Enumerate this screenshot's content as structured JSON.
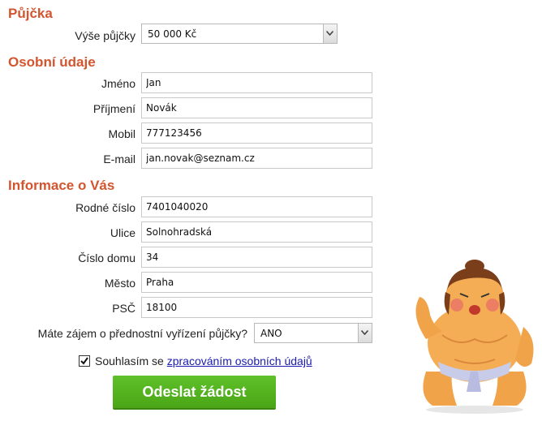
{
  "loan": {
    "title": "Půjčka",
    "amount_label": "Výše půjčky",
    "amount_value": "50 000 Kč"
  },
  "personal": {
    "title": "Osobní údaje",
    "first_name_label": "Jméno",
    "first_name_value": "Jan",
    "last_name_label": "Příjmení",
    "last_name_value": "Novák",
    "mobile_label": "Mobil",
    "mobile_value": "777123456",
    "email_label": "E-mail",
    "email_value": "jan.novak@seznam.cz"
  },
  "info": {
    "title": "Informace o Vás",
    "birth_number_label": "Rodné číslo",
    "birth_number_value": "7401040020",
    "street_label": "Ulice",
    "street_value": "Solnohradská",
    "house_number_label": "Číslo domu",
    "house_number_value": "34",
    "city_label": "Město",
    "city_value": "Praha",
    "zip_label": "PSČ",
    "zip_value": "18100",
    "priority_label": "Máte zájem o přednostní vyřízení půjčky?",
    "priority_value": "ANO"
  },
  "consent": {
    "prefix": "Souhlasím se",
    "link": "zpracováním osobních údajů",
    "checked": true
  },
  "submit_label": "Odeslat žádost",
  "colors": {
    "section_title": "#d2552f",
    "submit_button": "#4aa516",
    "link": "#1a1ab0"
  },
  "icons": [
    "chevron-down-icon",
    "checkmark-icon",
    "sumo-mascot-icon"
  ]
}
